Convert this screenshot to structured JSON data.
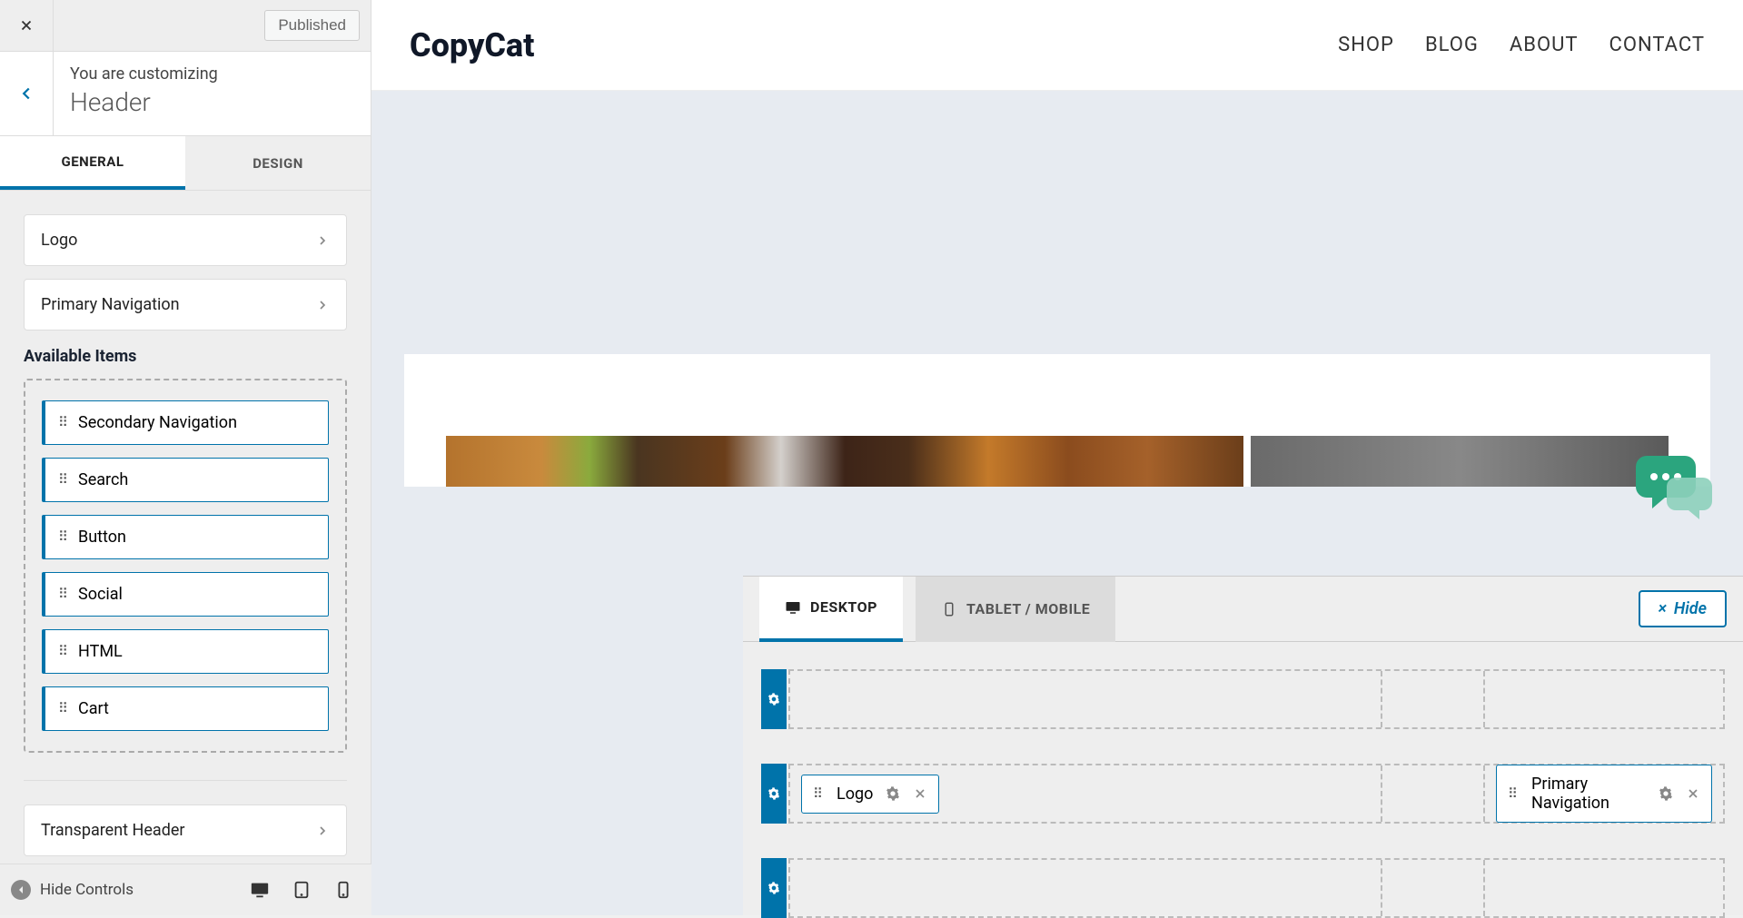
{
  "sidebar": {
    "published": "Published",
    "subtitle": "You are customizing",
    "title": "Header",
    "tabs": {
      "general": "GENERAL",
      "design": "DESIGN"
    },
    "options": {
      "logo": "Logo",
      "primary_nav": "Primary Navigation",
      "transparent": "Transparent Header"
    },
    "available_title": "Available Items",
    "available": [
      "Secondary Navigation",
      "Search",
      "Button",
      "Social",
      "HTML",
      "Cart"
    ]
  },
  "bottom": {
    "hide_controls": "Hide Controls"
  },
  "site": {
    "logo": "CopyCat",
    "nav": [
      "SHOP",
      "BLOG",
      "ABOUT",
      "CONTACT"
    ]
  },
  "builder": {
    "tabs": {
      "desktop": "DESKTOP",
      "tablet": "TABLET / MOBILE"
    },
    "hide": "Hide",
    "placed": {
      "logo": "Logo",
      "primary_nav": "Primary Navigation"
    }
  }
}
